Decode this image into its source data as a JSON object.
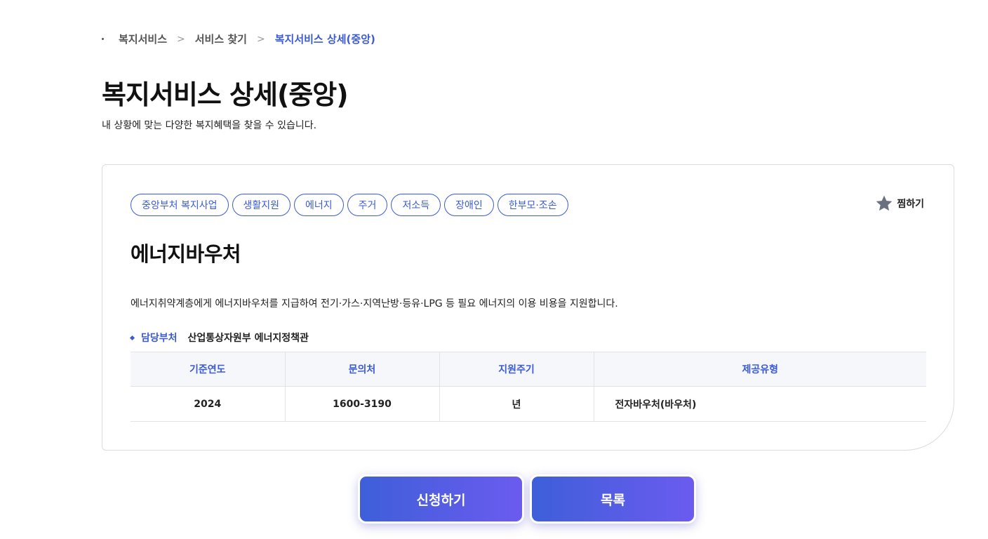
{
  "breadcrumb": {
    "items": [
      "복지서비스",
      "서비스 찾기",
      "복지서비스 상세(중앙)"
    ]
  },
  "page": {
    "title": "복지서비스 상세(중앙)",
    "subtitle": "내 상황에 맞는 다양한 복지혜택을 찾을 수 있습니다."
  },
  "card": {
    "tags": [
      "중앙부처 복지사업",
      "생활지원",
      "에너지",
      "주거",
      "저소득",
      "장애인",
      "한부모·조손"
    ],
    "favorite_label": "찜하기",
    "service_title": "에너지바우처",
    "description": "에너지취약계층에게 에너지바우처를 지급하여 전기·가스·지역난방·등유·LPG 등 필요 에너지의 이용 비용을 지원합니다.",
    "dept_label": "담당부처",
    "dept_value": "산업통상자원부 에너지정책관",
    "table": {
      "headers": [
        "기준연도",
        "문의처",
        "지원주기",
        "제공유형"
      ],
      "row": [
        "2024",
        "1600-3190",
        "년",
        "전자바우처(바우처)"
      ]
    }
  },
  "buttons": {
    "apply": "신청하기",
    "list": "목록"
  },
  "colors": {
    "accent": "#3b5bd6",
    "button_gradient_start": "#3e5fd9",
    "button_gradient_end": "#6b5bef",
    "star": "#6b7080"
  },
  "icons": {
    "favorite": "star-icon",
    "separator": "chevron-right-icon",
    "bullet": "diamond-icon"
  }
}
